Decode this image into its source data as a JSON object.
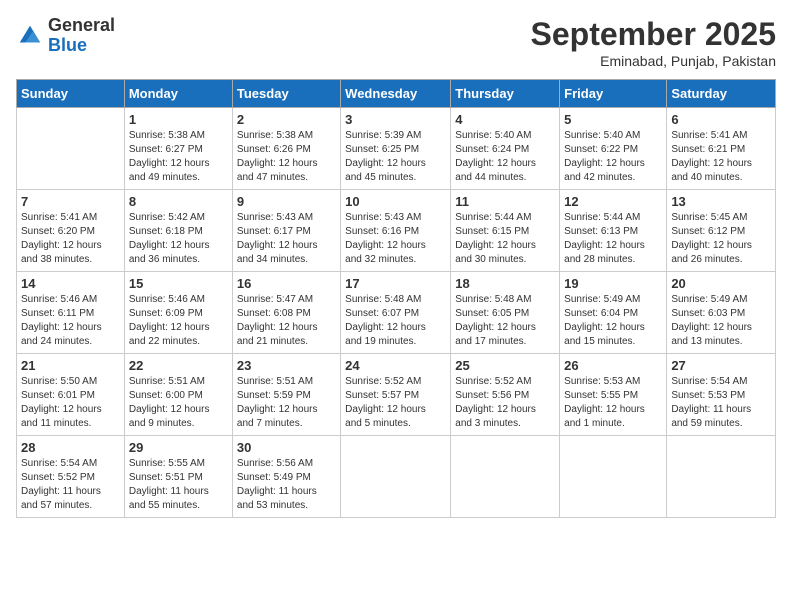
{
  "header": {
    "logo_general": "General",
    "logo_blue": "Blue",
    "month_title": "September 2025",
    "location": "Eminabad, Punjab, Pakistan"
  },
  "days_of_week": [
    "Sunday",
    "Monday",
    "Tuesday",
    "Wednesday",
    "Thursday",
    "Friday",
    "Saturday"
  ],
  "weeks": [
    [
      {
        "day": "",
        "info": ""
      },
      {
        "day": "1",
        "info": "Sunrise: 5:38 AM\nSunset: 6:27 PM\nDaylight: 12 hours\nand 49 minutes."
      },
      {
        "day": "2",
        "info": "Sunrise: 5:38 AM\nSunset: 6:26 PM\nDaylight: 12 hours\nand 47 minutes."
      },
      {
        "day": "3",
        "info": "Sunrise: 5:39 AM\nSunset: 6:25 PM\nDaylight: 12 hours\nand 45 minutes."
      },
      {
        "day": "4",
        "info": "Sunrise: 5:40 AM\nSunset: 6:24 PM\nDaylight: 12 hours\nand 44 minutes."
      },
      {
        "day": "5",
        "info": "Sunrise: 5:40 AM\nSunset: 6:22 PM\nDaylight: 12 hours\nand 42 minutes."
      },
      {
        "day": "6",
        "info": "Sunrise: 5:41 AM\nSunset: 6:21 PM\nDaylight: 12 hours\nand 40 minutes."
      }
    ],
    [
      {
        "day": "7",
        "info": "Sunrise: 5:41 AM\nSunset: 6:20 PM\nDaylight: 12 hours\nand 38 minutes."
      },
      {
        "day": "8",
        "info": "Sunrise: 5:42 AM\nSunset: 6:18 PM\nDaylight: 12 hours\nand 36 minutes."
      },
      {
        "day": "9",
        "info": "Sunrise: 5:43 AM\nSunset: 6:17 PM\nDaylight: 12 hours\nand 34 minutes."
      },
      {
        "day": "10",
        "info": "Sunrise: 5:43 AM\nSunset: 6:16 PM\nDaylight: 12 hours\nand 32 minutes."
      },
      {
        "day": "11",
        "info": "Sunrise: 5:44 AM\nSunset: 6:15 PM\nDaylight: 12 hours\nand 30 minutes."
      },
      {
        "day": "12",
        "info": "Sunrise: 5:44 AM\nSunset: 6:13 PM\nDaylight: 12 hours\nand 28 minutes."
      },
      {
        "day": "13",
        "info": "Sunrise: 5:45 AM\nSunset: 6:12 PM\nDaylight: 12 hours\nand 26 minutes."
      }
    ],
    [
      {
        "day": "14",
        "info": "Sunrise: 5:46 AM\nSunset: 6:11 PM\nDaylight: 12 hours\nand 24 minutes."
      },
      {
        "day": "15",
        "info": "Sunrise: 5:46 AM\nSunset: 6:09 PM\nDaylight: 12 hours\nand 22 minutes."
      },
      {
        "day": "16",
        "info": "Sunrise: 5:47 AM\nSunset: 6:08 PM\nDaylight: 12 hours\nand 21 minutes."
      },
      {
        "day": "17",
        "info": "Sunrise: 5:48 AM\nSunset: 6:07 PM\nDaylight: 12 hours\nand 19 minutes."
      },
      {
        "day": "18",
        "info": "Sunrise: 5:48 AM\nSunset: 6:05 PM\nDaylight: 12 hours\nand 17 minutes."
      },
      {
        "day": "19",
        "info": "Sunrise: 5:49 AM\nSunset: 6:04 PM\nDaylight: 12 hours\nand 15 minutes."
      },
      {
        "day": "20",
        "info": "Sunrise: 5:49 AM\nSunset: 6:03 PM\nDaylight: 12 hours\nand 13 minutes."
      }
    ],
    [
      {
        "day": "21",
        "info": "Sunrise: 5:50 AM\nSunset: 6:01 PM\nDaylight: 12 hours\nand 11 minutes."
      },
      {
        "day": "22",
        "info": "Sunrise: 5:51 AM\nSunset: 6:00 PM\nDaylight: 12 hours\nand 9 minutes."
      },
      {
        "day": "23",
        "info": "Sunrise: 5:51 AM\nSunset: 5:59 PM\nDaylight: 12 hours\nand 7 minutes."
      },
      {
        "day": "24",
        "info": "Sunrise: 5:52 AM\nSunset: 5:57 PM\nDaylight: 12 hours\nand 5 minutes."
      },
      {
        "day": "25",
        "info": "Sunrise: 5:52 AM\nSunset: 5:56 PM\nDaylight: 12 hours\nand 3 minutes."
      },
      {
        "day": "26",
        "info": "Sunrise: 5:53 AM\nSunset: 5:55 PM\nDaylight: 12 hours\nand 1 minute."
      },
      {
        "day": "27",
        "info": "Sunrise: 5:54 AM\nSunset: 5:53 PM\nDaylight: 11 hours\nand 59 minutes."
      }
    ],
    [
      {
        "day": "28",
        "info": "Sunrise: 5:54 AM\nSunset: 5:52 PM\nDaylight: 11 hours\nand 57 minutes."
      },
      {
        "day": "29",
        "info": "Sunrise: 5:55 AM\nSunset: 5:51 PM\nDaylight: 11 hours\nand 55 minutes."
      },
      {
        "day": "30",
        "info": "Sunrise: 5:56 AM\nSunset: 5:49 PM\nDaylight: 11 hours\nand 53 minutes."
      },
      {
        "day": "",
        "info": ""
      },
      {
        "day": "",
        "info": ""
      },
      {
        "day": "",
        "info": ""
      },
      {
        "day": "",
        "info": ""
      }
    ]
  ]
}
